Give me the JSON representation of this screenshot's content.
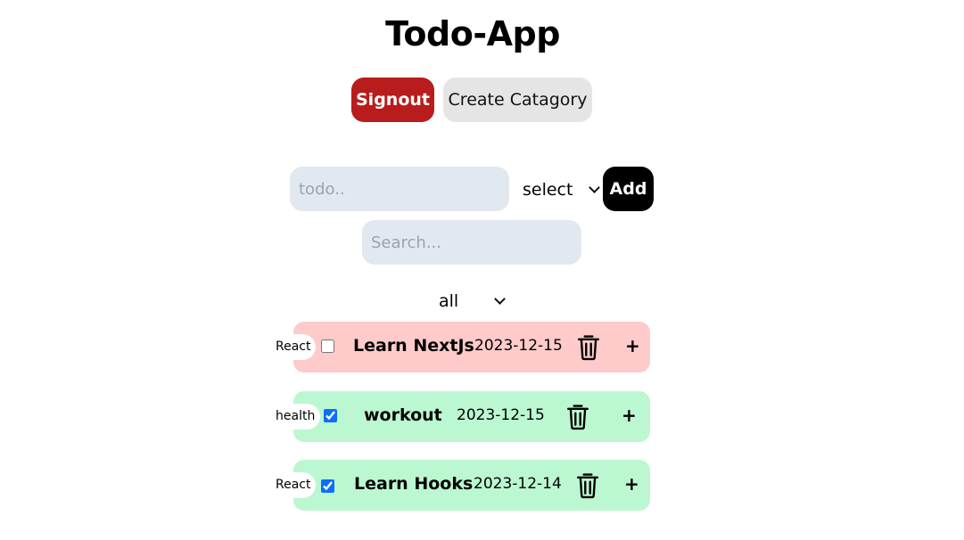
{
  "app": {
    "title": "Todo-App"
  },
  "header": {
    "signout_label": "Signout",
    "create_category_label": "Create Catagory"
  },
  "form": {
    "todo_placeholder": "todo..",
    "todo_value": "",
    "category_select_value": "select",
    "add_label": "Add"
  },
  "search": {
    "placeholder": "Search...",
    "value": ""
  },
  "filter": {
    "selected": "all"
  },
  "todos": [
    {
      "category": "React",
      "checked": false,
      "text": "Learn NextJs",
      "date": "2023-12-15",
      "status_color": "#fecaca",
      "delete_icon": "trash-icon",
      "add_symbol": "+"
    },
    {
      "category": "health",
      "checked": true,
      "text": "workout",
      "date": "2023-12-15",
      "status_color": "#bbf7d0",
      "delete_icon": "trash-icon",
      "add_symbol": "+"
    },
    {
      "category": "React",
      "checked": true,
      "text": "Learn Hooks",
      "date": "2023-12-14",
      "status_color": "#bbf7d0",
      "delete_icon": "trash-icon",
      "add_symbol": "+"
    }
  ],
  "colors": {
    "signout_bg": "#b91c1c",
    "category_btn_bg": "#e5e5e5",
    "input_bg": "#e2e8f0",
    "add_bg": "#000000",
    "pending_bg": "#fecaca",
    "done_bg": "#bbf7d0"
  }
}
